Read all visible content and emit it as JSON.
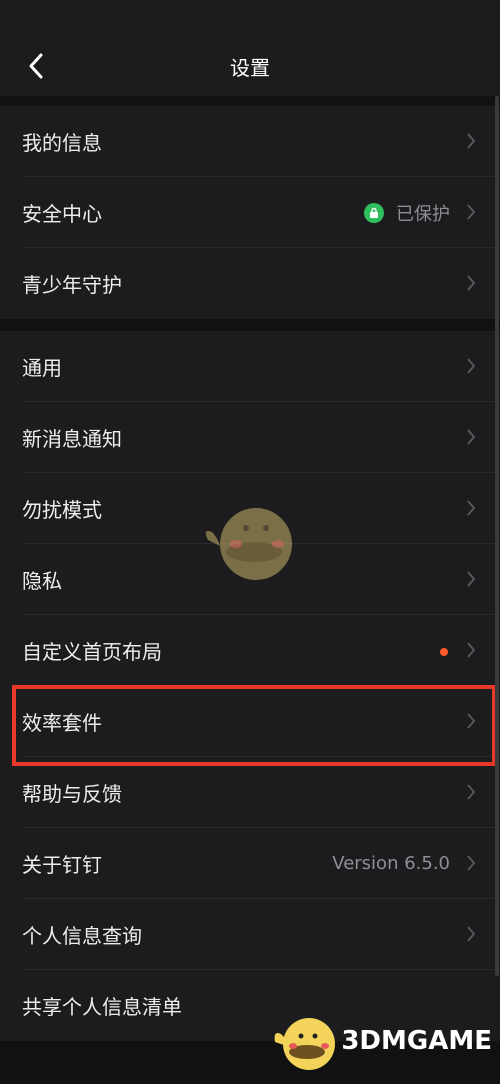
{
  "header": {
    "title": "设置"
  },
  "group1": [
    {
      "label": "我的信息"
    },
    {
      "label": "安全中心",
      "value": "已保护"
    },
    {
      "label": "青少年守护"
    }
  ],
  "group2": [
    {
      "label": "通用"
    },
    {
      "label": "新消息通知"
    },
    {
      "label": "勿扰模式"
    },
    {
      "label": "隐私"
    },
    {
      "label": "自定义首页布局"
    },
    {
      "label": "效率套件"
    },
    {
      "label": "帮助与反馈"
    },
    {
      "label": "关于钉钉",
      "value": "Version 6.5.0"
    },
    {
      "label": "个人信息查询"
    },
    {
      "label": "共享个人信息清单"
    }
  ],
  "watermark": {
    "text": "3DMGAME"
  },
  "colors": {
    "highlight": "#e8382a",
    "dot": "#ff5a2b",
    "shield": "#2fbf5e"
  }
}
